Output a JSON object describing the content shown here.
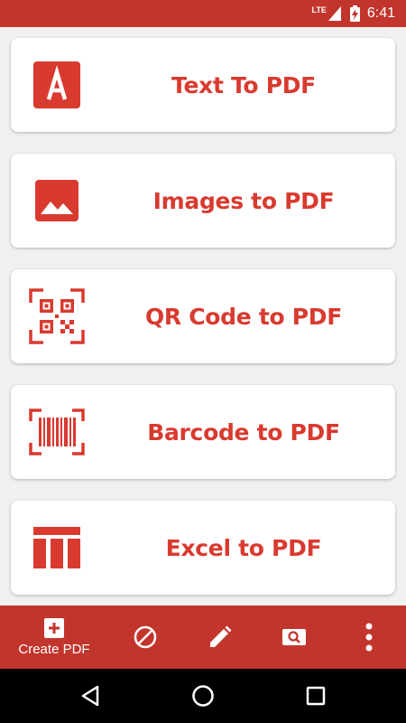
{
  "status_bar": {
    "network": "LTE",
    "time": "6:41"
  },
  "cards": [
    {
      "label": "Text To PDF",
      "icon": "text-a-icon"
    },
    {
      "label": "Images to PDF",
      "icon": "image-icon"
    },
    {
      "label": "QR Code to PDF",
      "icon": "qr-code-icon"
    },
    {
      "label": "Barcode to PDF",
      "icon": "barcode-icon"
    },
    {
      "label": "Excel to PDF",
      "icon": "table-icon"
    }
  ],
  "bottom_nav": {
    "create_pdf_label": "Create PDF",
    "items": [
      "plus-icon",
      "block-icon",
      "pencil-icon",
      "search-image-icon",
      "more-vert-icon"
    ]
  },
  "colors": {
    "accent": "#d93a2f",
    "bar": "#c2352d",
    "background": "#f0f0f0"
  }
}
